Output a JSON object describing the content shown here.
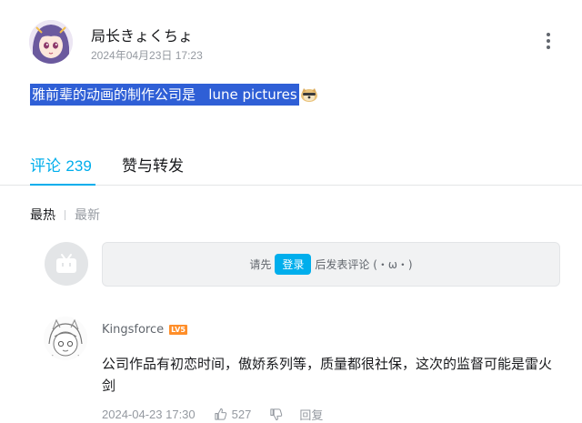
{
  "post": {
    "author_name": "局长きょくちょ",
    "time": "2024年04月23日 17:23",
    "content": "雅前辈的动画的制作公司是   lune pictures",
    "emoji": "doge-emoji"
  },
  "tabs": {
    "comments_label": "评论",
    "comments_count": "239",
    "likes_label": "赞与转发"
  },
  "sort": {
    "hot": "最热",
    "new": "最新"
  },
  "composer": {
    "prefix": "请先",
    "login": "登录",
    "suffix": "后发表评论 (・ω・)"
  },
  "reply": {
    "username": "Kingsforce",
    "level": "LV5",
    "text": "公司作品有初恋时间，傲娇系列等，质量都很社保，这次的监督可能是雷火剑",
    "time": "2024-04-23 17:30",
    "likes": "527",
    "reply_label": "回复"
  },
  "colors": {
    "accent": "#00aeec",
    "selection": "#2f5fd6",
    "level_badge": "#ff8e29"
  }
}
